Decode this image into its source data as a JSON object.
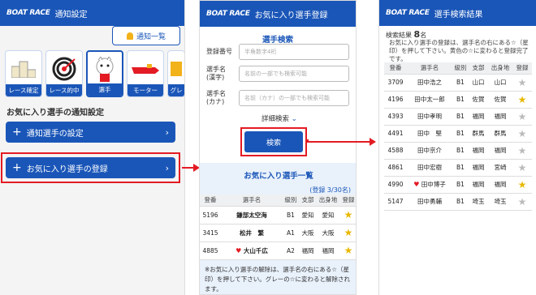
{
  "panel1": {
    "logo": "BOAT RACE",
    "title": "通知設定",
    "notif_list_label": "通知一覧",
    "icons": [
      {
        "label": "レース確定",
        "icon": "podium-icon"
      },
      {
        "label": "レース的中",
        "icon": "target-icon"
      },
      {
        "label": "選手",
        "icon": "player-mascot-icon"
      },
      {
        "label": "モーター",
        "icon": "boat-icon"
      },
      {
        "label": "グレ",
        "icon": "grade-icon"
      }
    ],
    "section_title": "お気に入り選手の通知設定",
    "btn_notif_player": "通知選手の設定",
    "btn_register_fav": "お気に入り選手の登録",
    "plus": "+",
    "chev": "›"
  },
  "panel2": {
    "logo": "BOAT RACE",
    "title": "お気に入り選手登録",
    "search_heading": "選手検索",
    "fields": [
      {
        "label": "登録番号",
        "placeholder": "半角数字4桁"
      },
      {
        "label": "選手名\n(漢字)",
        "placeholder": "名前の一部でも検索可能"
      },
      {
        "label": "選手名\n(カナ)",
        "placeholder": "名前（カナ）の一部でも検索可能"
      }
    ],
    "detail_search": "詳細検索",
    "detail_chev": "⌄",
    "search_btn": "検索",
    "fav_heading": "お気に入り選手一覧",
    "fav_count": "(登録 3/30名)",
    "columns": [
      "登番",
      "選手名",
      "級別",
      "支部",
      "出身地",
      "登録"
    ],
    "rows": [
      {
        "no": "5196",
        "name": "鎌部太空海",
        "cls": "B1",
        "branch": "愛知",
        "home": "愛知",
        "heart": false
      },
      {
        "no": "3415",
        "name": "松井　繁",
        "cls": "A1",
        "branch": "大阪",
        "home": "大阪",
        "heart": false
      },
      {
        "no": "4885",
        "name": "大山千広",
        "cls": "A2",
        "branch": "福岡",
        "home": "福岡",
        "heart": true
      }
    ],
    "note": "※お気に入り選手の解除は、選手名の右にある☆（星印）を押して下さい。グレーの☆に変わると解除されます。"
  },
  "panel3": {
    "logo": "BOAT RACE",
    "title": "選手検索結果",
    "result_label": "検索結果",
    "result_count": "8",
    "result_unit": "名",
    "note": "お気に入り選手の登録は、選手名の右にある☆（星印）を押して下さい。黄色の☆に変わると登録完了です。",
    "columns": [
      "登番",
      "選手名",
      "級別",
      "支部",
      "出身地",
      "登録"
    ],
    "rows": [
      {
        "no": "3709",
        "name": "田中浩之",
        "cls": "B1",
        "branch": "山口",
        "home": "山口",
        "fav": false,
        "heart": false
      },
      {
        "no": "4196",
        "name": "田中太一郎",
        "cls": "B1",
        "branch": "佐賀",
        "home": "佐賀",
        "fav": true,
        "heart": false
      },
      {
        "no": "4393",
        "name": "田中孝明",
        "cls": "B1",
        "branch": "福岡",
        "home": "福岡",
        "fav": false,
        "heart": false
      },
      {
        "no": "4491",
        "name": "田中　堅",
        "cls": "B1",
        "branch": "群馬",
        "home": "群馬",
        "fav": false,
        "heart": false
      },
      {
        "no": "4588",
        "name": "田中京介",
        "cls": "B1",
        "branch": "福岡",
        "home": "福岡",
        "fav": false,
        "heart": false
      },
      {
        "no": "4861",
        "name": "田中宏樹",
        "cls": "B1",
        "branch": "福岡",
        "home": "宮崎",
        "fav": false,
        "heart": false
      },
      {
        "no": "4990",
        "name": "田中博子",
        "cls": "B1",
        "branch": "福岡",
        "home": "福岡",
        "fav": true,
        "heart": true
      },
      {
        "no": "5147",
        "name": "田中勇輔",
        "cls": "B1",
        "branch": "埼玉",
        "home": "埼玉",
        "fav": false,
        "heart": false
      }
    ]
  },
  "star": "★",
  "heart": "♥",
  "colors": {
    "brand": "#1a56b8",
    "highlight": "#e31b23",
    "star_on": "#e8b800",
    "star_off": "#bbbbbb"
  }
}
